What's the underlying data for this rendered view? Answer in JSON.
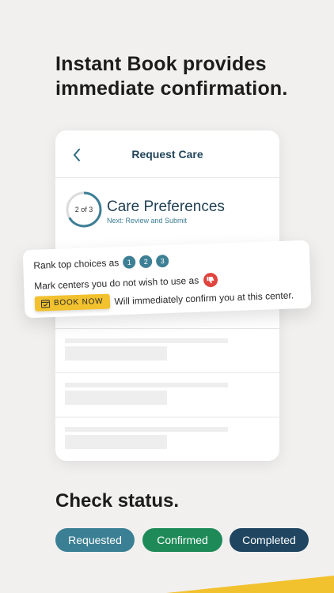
{
  "headline": "Instant Book provides immediate confirmation.",
  "card": {
    "title": "Request Care",
    "progress_label": "2 of 3",
    "section_title": "Care Preferences",
    "next_label": "Next: Review and Submit"
  },
  "popover": {
    "rank_text": "Rank top choices as",
    "rank_numbers": [
      "1",
      "2",
      "3"
    ],
    "mark_text": "Mark centers you do not wish to use as",
    "book_now_label": "BOOK NOW",
    "book_now_text": "Will immediately confirm you at this center."
  },
  "status": {
    "heading": "Check status.",
    "pills": [
      {
        "label": "Requested",
        "color": "#3a7f93"
      },
      {
        "label": "Confirmed",
        "color": "#1e8a58"
      },
      {
        "label": "Completed",
        "color": "#1f4560"
      }
    ]
  },
  "colors": {
    "accent_yellow": "#f2c12e",
    "brand_teal": "#3d7f95",
    "dislike_red": "#e0453f"
  },
  "icons": {
    "back": "chevron-left-icon",
    "dislike": "thumbs-down-icon",
    "calendar": "calendar-check-icon"
  }
}
